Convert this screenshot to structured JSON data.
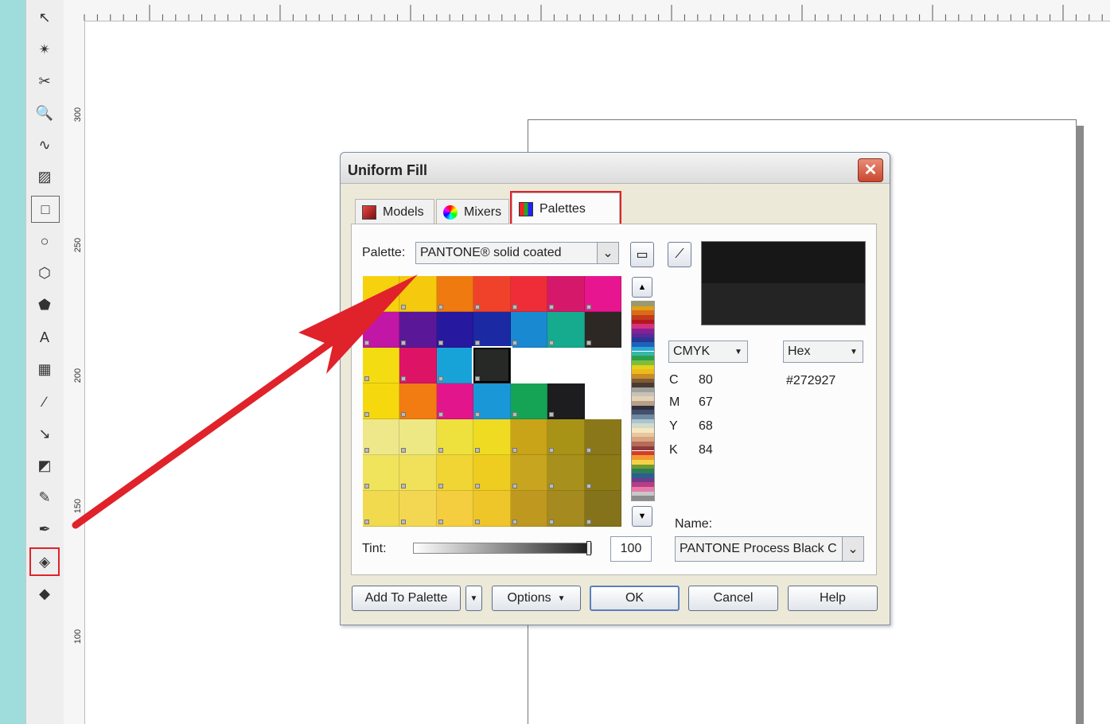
{
  "colors": {
    "accent_highlight": "#e0222a",
    "selected_color": "#272927"
  },
  "toolbox": {
    "tools": [
      {
        "name": "pick-tool-icon",
        "glyph": "↖"
      },
      {
        "name": "shape-tool-icon",
        "glyph": "✴"
      },
      {
        "name": "crop-tool-icon",
        "glyph": "✂"
      },
      {
        "name": "zoom-tool-icon",
        "glyph": "🔍"
      },
      {
        "name": "freehand-tool-icon",
        "glyph": "∿"
      },
      {
        "name": "smart-fill-tool-icon",
        "glyph": "▨"
      },
      {
        "name": "rectangle-tool-icon",
        "glyph": "□"
      },
      {
        "name": "ellipse-tool-icon",
        "glyph": "○"
      },
      {
        "name": "polygon-tool-icon",
        "glyph": "⬡"
      },
      {
        "name": "basic-shapes-tool-icon",
        "glyph": "⬟"
      },
      {
        "name": "text-tool-icon",
        "glyph": "A"
      },
      {
        "name": "table-tool-icon",
        "glyph": "▦"
      },
      {
        "name": "dimension-tool-icon",
        "glyph": "∕"
      },
      {
        "name": "connector-tool-icon",
        "glyph": "↘"
      },
      {
        "name": "blend-tool-icon",
        "glyph": "◩"
      },
      {
        "name": "eyedropper-tool-icon",
        "glyph": "✎"
      },
      {
        "name": "outline-tool-icon",
        "glyph": "✒"
      },
      {
        "name": "fill-tool-icon",
        "glyph": "◈"
      },
      {
        "name": "interactive-fill-tool-icon",
        "glyph": "◆"
      }
    ]
  },
  "rulers": {
    "left_marks": [
      "300",
      "250",
      "200",
      "150",
      "100"
    ]
  },
  "dialog": {
    "title": "Uniform Fill",
    "tabs": [
      "Models",
      "Mixers",
      "Palettes"
    ],
    "palette_label": "Palette:",
    "palette_value": "PANTONE® solid coated",
    "color_model": "CMYK",
    "value_format": "Hex",
    "cmyk": [
      {
        "letter": "C",
        "value": "80"
      },
      {
        "letter": "M",
        "value": "67"
      },
      {
        "letter": "Y",
        "value": "68"
      },
      {
        "letter": "K",
        "value": "84"
      }
    ],
    "hex_value": "#272927",
    "name_label": "Name:",
    "name_value": "PANTONE Process Black C",
    "tint_label": "Tint:",
    "tint_value": "100",
    "tint_level": 1.0,
    "buttons": {
      "add_to_palette": "Add To Palette",
      "options": "Options",
      "ok": "OK",
      "cancel": "Cancel",
      "help": "Help"
    }
  },
  "swatches": [
    [
      "#f6d20e",
      "#f4c90e",
      "#ef7a10",
      "#f0422b",
      "#ee2d39",
      "#d6186b",
      "#e71590"
    ],
    [
      "#c216a6",
      "#5a1898",
      "#2718a0",
      "#1b29a3",
      "#1989d2",
      "#16aa8f",
      "#2d2824"
    ],
    [
      "#f4dc12",
      "#dd1466",
      "#18a3d8",
      "#272927",
      "#ffffff",
      "#ffffff",
      "#ffffff"
    ],
    [
      "#f6d80f",
      "#f27b12",
      "#e3158c",
      "#1a97d7",
      "#15a455",
      "#1d1c1f",
      "#ffffff"
    ],
    [
      "#efe88a",
      "#ede884",
      "#eee03d",
      "#efdb21",
      "#c9a318",
      "#a99316",
      "#897719"
    ],
    [
      "#f0e45c",
      "#f0e05a",
      "#f0d534",
      "#efcc20",
      "#c8a51e",
      "#a7901c",
      "#8c7a17"
    ],
    [
      "#f2da4e",
      "#f3d753",
      "#f4ce3e",
      "#efc629",
      "#bf991f",
      "#a48a1f",
      "#85731c"
    ]
  ]
}
